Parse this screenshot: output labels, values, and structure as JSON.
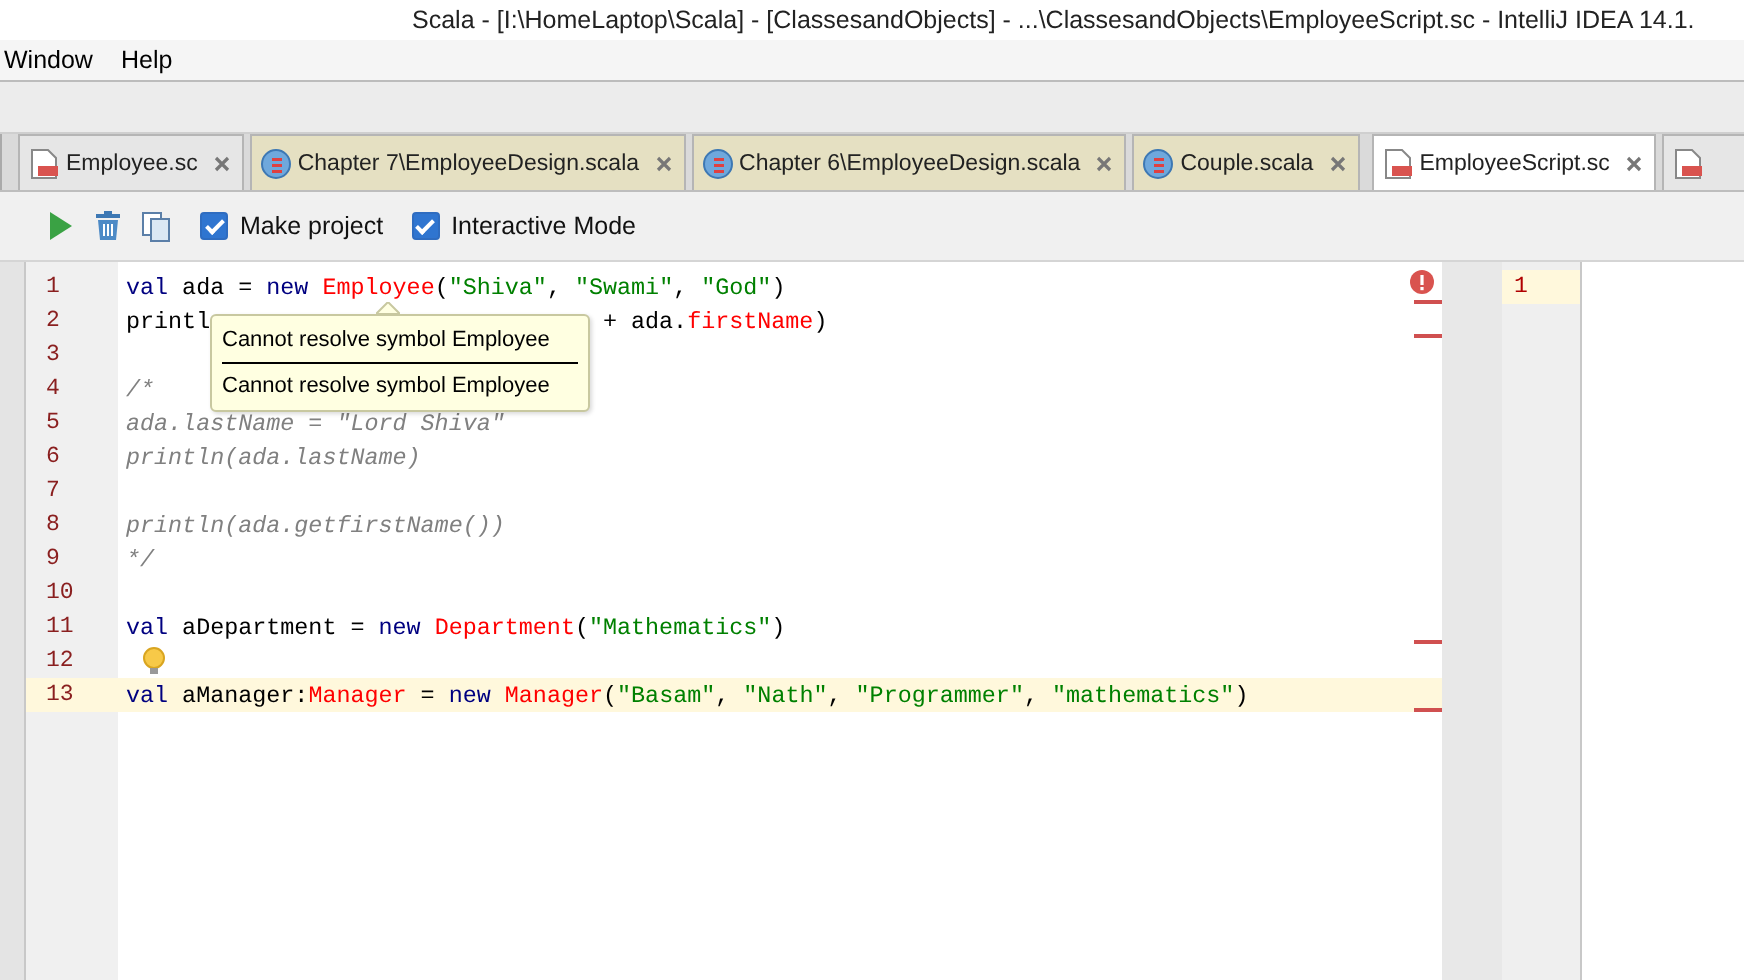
{
  "window": {
    "title": "Scala - [I:\\HomeLaptop\\Scala] - [ClassesandObjects] - ...\\ClassesandObjects\\EmployeeScript.sc - IntelliJ IDEA 14.1."
  },
  "menu": [
    {
      "label": "Window"
    },
    {
      "label": "Help"
    }
  ],
  "tabs": [
    {
      "label": "Employee.sc",
      "kind": "script",
      "selected": false
    },
    {
      "label": "Chapter 7\\EmployeeDesign.scala",
      "kind": "scala",
      "selected": false
    },
    {
      "label": "Chapter 6\\EmployeeDesign.scala",
      "kind": "scala",
      "selected": false
    },
    {
      "label": "Couple.scala",
      "kind": "scala",
      "selected": false
    },
    {
      "label": "EmployeeScript.sc",
      "kind": "script",
      "selected": true
    },
    {
      "kind": "script-cut",
      "selected": false
    }
  ],
  "editor_toolbar": {
    "checkboxes": [
      {
        "label": "Make project",
        "checked": true
      },
      {
        "label": "Interactive Mode",
        "checked": true
      }
    ]
  },
  "code": [
    {
      "number": "1",
      "current": false,
      "error": true,
      "tokens": [
        {
          "kind": "kw",
          "text": "val"
        },
        {
          "kind": "plain",
          "text": " ada = "
        },
        {
          "kind": "kw",
          "text": "new "
        },
        {
          "kind": "err",
          "text": "Employee"
        },
        {
          "kind": "plain",
          "text": "("
        },
        {
          "kind": "str",
          "text": "\"Shiva\""
        },
        {
          "kind": "plain",
          "text": ", "
        },
        {
          "kind": "str",
          "text": "\"Swami\""
        },
        {
          "kind": "plain",
          "text": ", "
        },
        {
          "kind": "str",
          "text": "\"God\""
        },
        {
          "kind": "plain",
          "text": ")"
        }
      ]
    },
    {
      "number": "2",
      "current": false,
      "error": true,
      "tokens": [
        {
          "kind": "plain",
          "text": "printl"
        },
        {
          "kind": "after-cover",
          "text": " + ada."
        },
        {
          "kind": "err",
          "text": "firstName"
        },
        {
          "kind": "plain",
          "text": ")"
        }
      ]
    },
    {
      "number": "3",
      "current": false,
      "error": false
    },
    {
      "number": "4",
      "current": false,
      "error": false,
      "tokens": [
        {
          "kind": "comment",
          "text": "/*"
        }
      ]
    },
    {
      "number": "5",
      "current": false,
      "error": false,
      "tokens": [
        {
          "kind": "comment",
          "text": "ada.lastName = \"Lord Shiva\""
        }
      ]
    },
    {
      "number": "6",
      "current": false,
      "error": false,
      "tokens": [
        {
          "kind": "comment",
          "text": "println(ada.lastName)"
        }
      ]
    },
    {
      "number": "7",
      "current": false,
      "error": false
    },
    {
      "number": "8",
      "current": false,
      "error": false,
      "tokens": [
        {
          "kind": "comment",
          "text": "println(ada.getfirstName())"
        }
      ]
    },
    {
      "number": "9",
      "current": false,
      "error": false,
      "tokens": [
        {
          "kind": "comment",
          "text": "*/"
        }
      ]
    },
    {
      "number": "10",
      "current": false,
      "error": false
    },
    {
      "number": "11",
      "current": false,
      "error": true,
      "tokens": [
        {
          "kind": "kw",
          "text": "val"
        },
        {
          "kind": "plain",
          "text": " aDepartment = "
        },
        {
          "kind": "kw",
          "text": "new "
        },
        {
          "kind": "err",
          "text": "Department"
        },
        {
          "kind": "plain",
          "text": "("
        },
        {
          "kind": "str",
          "text": "\"Mathematics\""
        },
        {
          "kind": "plain",
          "text": ")"
        }
      ]
    },
    {
      "number": "12",
      "current": false,
      "error": false,
      "bulb": true
    },
    {
      "number": "13",
      "current": true,
      "error": true,
      "tokens": [
        {
          "kind": "kw",
          "text": "val"
        },
        {
          "kind": "plain",
          "text": " aManager:"
        },
        {
          "kind": "err",
          "text": "Manager"
        },
        {
          "kind": "plain",
          "text": " = "
        },
        {
          "kind": "kw",
          "text": "new "
        },
        {
          "kind": "err",
          "text": "Manager"
        },
        {
          "kind": "plain",
          "text": "("
        },
        {
          "kind": "str",
          "text": "\"Basam\""
        },
        {
          "kind": "plain",
          "text": ", "
        },
        {
          "kind": "str",
          "text": "\"Nath\""
        },
        {
          "kind": "plain",
          "text": ", "
        },
        {
          "kind": "str",
          "text": "\"Programmer\""
        },
        {
          "kind": "plain",
          "text": ", "
        },
        {
          "kind": "str",
          "text": "\"mathematics\""
        },
        {
          "kind": "plain",
          "text": ")"
        }
      ]
    }
  ],
  "tooltip": {
    "messages": [
      "Cannot resolve symbol Employee",
      "Cannot resolve symbol Employee"
    ]
  },
  "output": {
    "lines": [
      "1"
    ]
  }
}
